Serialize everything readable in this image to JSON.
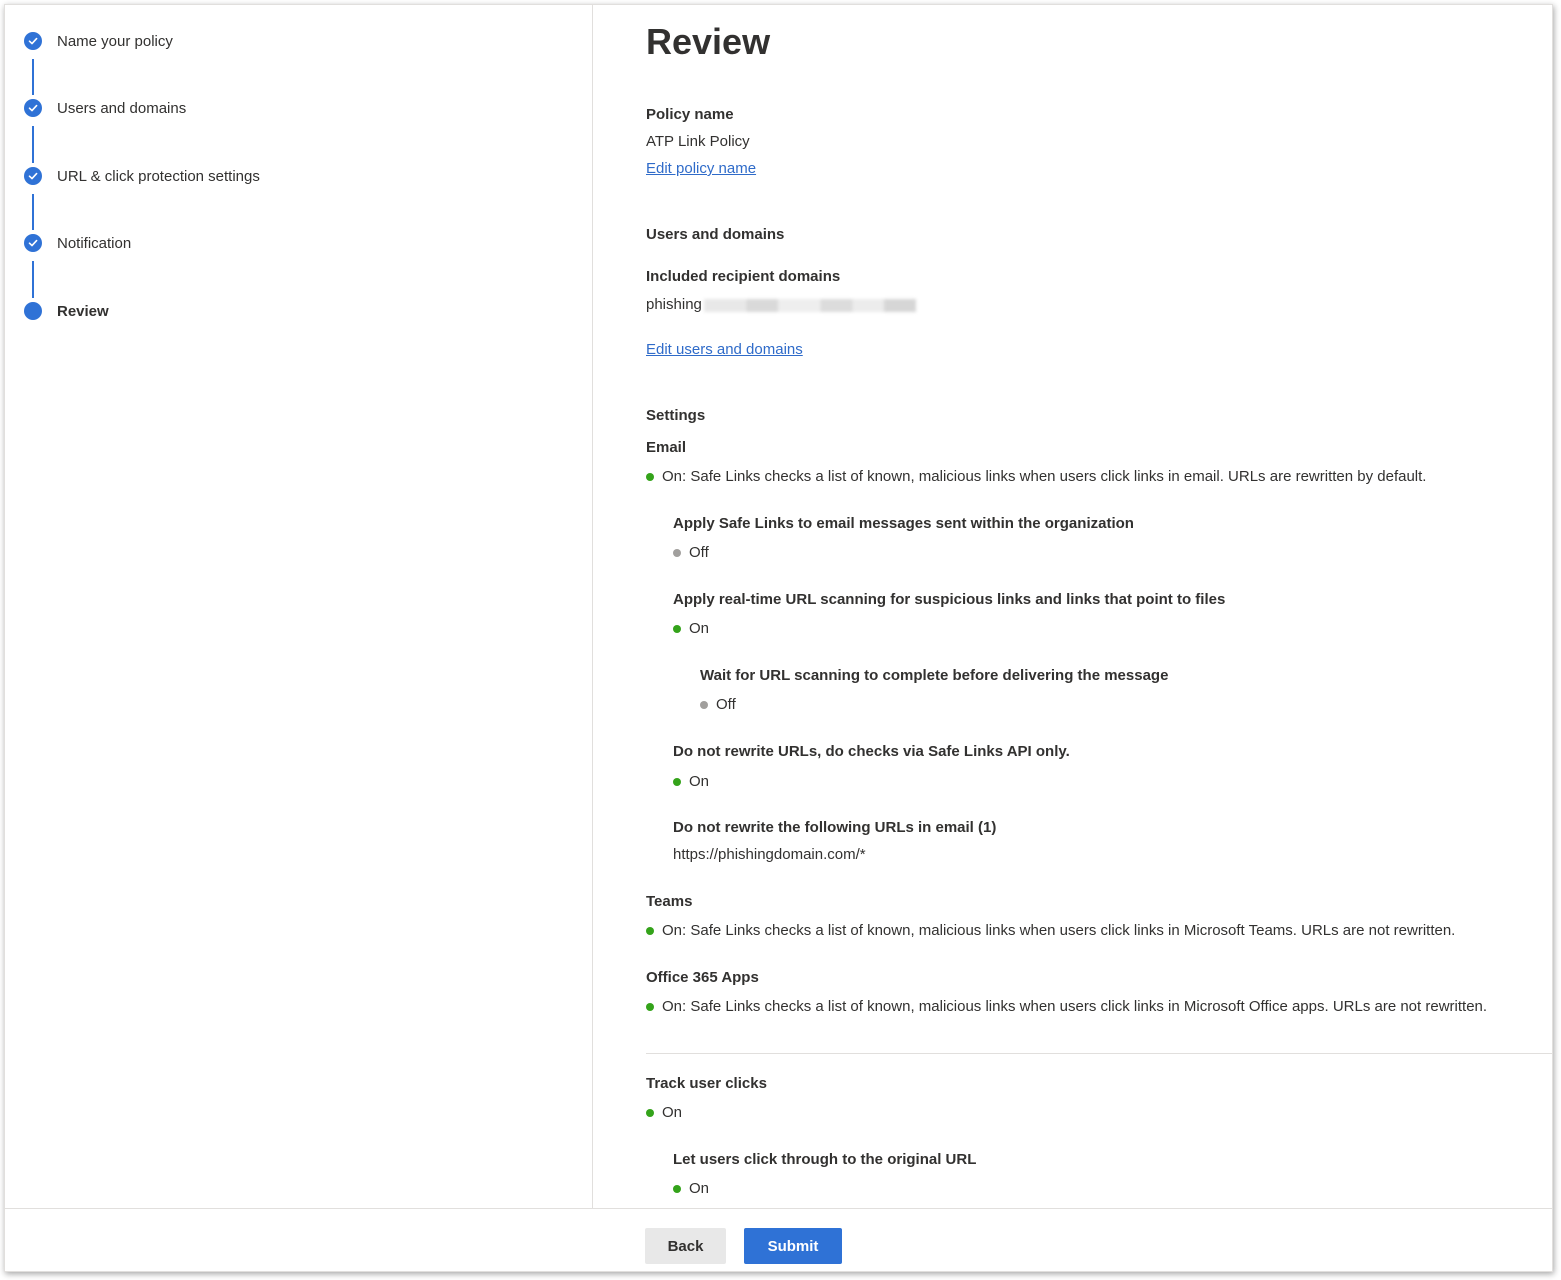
{
  "steps": [
    {
      "label": "Name your policy",
      "state": "completed"
    },
    {
      "label": "Users and domains",
      "state": "completed"
    },
    {
      "label": "URL & click protection settings",
      "state": "completed"
    },
    {
      "label": "Notification",
      "state": "completed"
    },
    {
      "label": "Review",
      "state": "current"
    }
  ],
  "review": {
    "title": "Review",
    "policy_name_label": "Policy name",
    "policy_name_value": "ATP Link Policy",
    "edit_policy_name": "Edit policy name",
    "users_domains_heading": "Users and domains",
    "included_domains_label": "Included recipient domains",
    "included_domains_value": "phishing",
    "edit_users_domains": "Edit users and domains",
    "settings_heading": "Settings",
    "email_heading": "Email",
    "email_status": "On: Safe Links checks a list of known, malicious links when users click links in email. URLs are rewritten by default.",
    "apply_internal_label": "Apply Safe Links to email messages sent within the organization",
    "apply_internal_status": "Off",
    "realtime_scan_label": "Apply real-time URL scanning for suspicious links and links that point to files",
    "realtime_scan_status": "On",
    "wait_scan_label": "Wait for URL scanning to complete before delivering the message",
    "wait_scan_status": "Off",
    "no_rewrite_api_label": "Do not rewrite URLs, do checks via Safe Links API only.",
    "no_rewrite_api_status": "On",
    "no_rewrite_list_label": "Do not rewrite the following URLs in email (1)",
    "no_rewrite_list_value": "https://phishingdomain.com/*",
    "teams_heading": "Teams",
    "teams_status": "On: Safe Links checks a list of known, malicious links when users click links in Microsoft Teams. URLs are not rewritten.",
    "office_heading": "Office 365 Apps",
    "office_status": "On: Safe Links checks a list of known, malicious links when users click links in Microsoft Office apps. URLs are not rewritten.",
    "track_clicks_label": "Track user clicks",
    "track_clicks_status": "On",
    "click_through_label": "Let users click through to the original URL",
    "click_through_status": "On"
  },
  "footer": {
    "back_label": "Back",
    "submit_label": "Submit"
  },
  "colors": {
    "accent": "#2f72d6",
    "link": "#2f6bc9",
    "status_on": "#34a31a",
    "status_off": "#a19f9d"
  },
  "icons": {
    "completed_step": "checkmark-icon",
    "current_step": "current-step-dot-icon",
    "status_on": "status-on-dot-icon",
    "status_off": "status-off-dot-icon"
  }
}
